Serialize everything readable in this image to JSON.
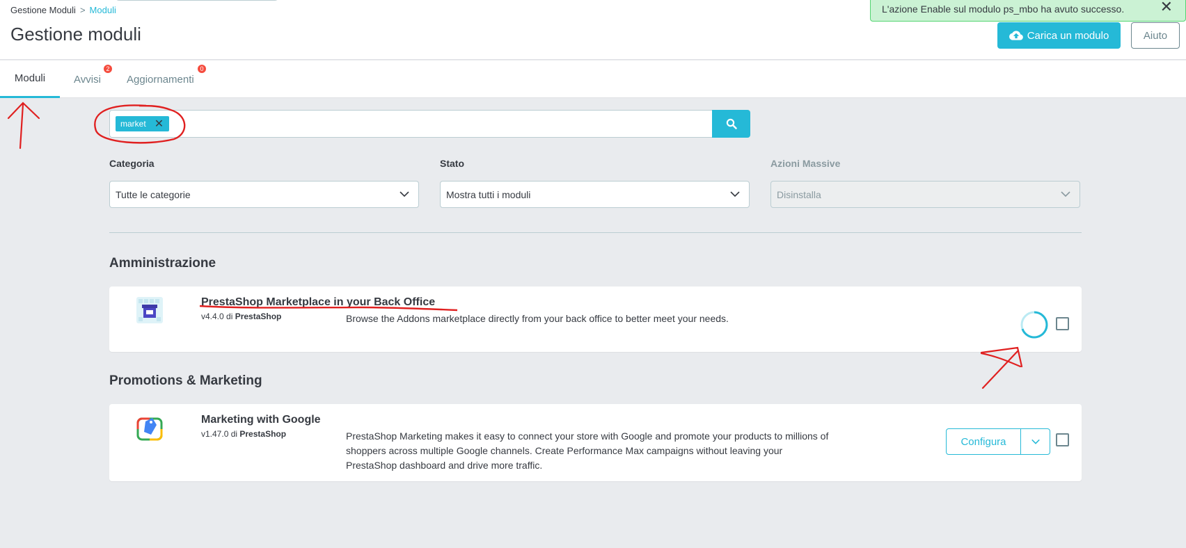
{
  "header": {
    "breadcrumb": [
      "Gestione Moduli",
      ">",
      "Moduli"
    ],
    "title": "Gestione moduli",
    "upload_label": "Carica un modulo",
    "help_label": "Aiuto"
  },
  "alert": {
    "message": "L'azione Enable sul modulo ps_mbo ha avuto successo.",
    "close": "✕"
  },
  "tabs": [
    {
      "label": "Moduli",
      "badge": null,
      "active": true
    },
    {
      "label": "Avvisi",
      "badge": "2",
      "active": false
    },
    {
      "label": "Aggiornamenti",
      "badge": "0",
      "active": false
    }
  ],
  "search": {
    "tag": "market",
    "tag_remove": "✕"
  },
  "filters": {
    "category_label": "Categoria",
    "category_value": "Tutte le categorie",
    "status_label": "Stato",
    "status_value": "Mostra tutti i moduli",
    "bulk_label": "Azioni Massive",
    "bulk_value": "Disinstalla"
  },
  "categories": [
    {
      "title": "Amministrazione",
      "module": {
        "name": "PrestaShop Marketplace in your Back Office",
        "version": "v4.4.0 di ",
        "author": "PrestaShop",
        "description": "Browse the Addons marketplace directly from your back office to better meet your needs."
      }
    },
    {
      "title": "Promotions & Marketing",
      "module": {
        "name": "Marketing with Google",
        "version": "v1.47.0 di ",
        "author": "PrestaShop",
        "description": "PrestaShop Marketing makes it easy to connect your store with Google and promote your products to millions of shoppers across multiple Google channels. Create Performance Max campaigns without leaving your PrestaShop dashboard and drive more traffic.",
        "action_label": "Configura"
      }
    }
  ],
  "colors": {
    "accent": "#25b9d7",
    "background": "#e9ebee",
    "annotation": "#e02020",
    "alert_bg": "#cbf2d4"
  }
}
